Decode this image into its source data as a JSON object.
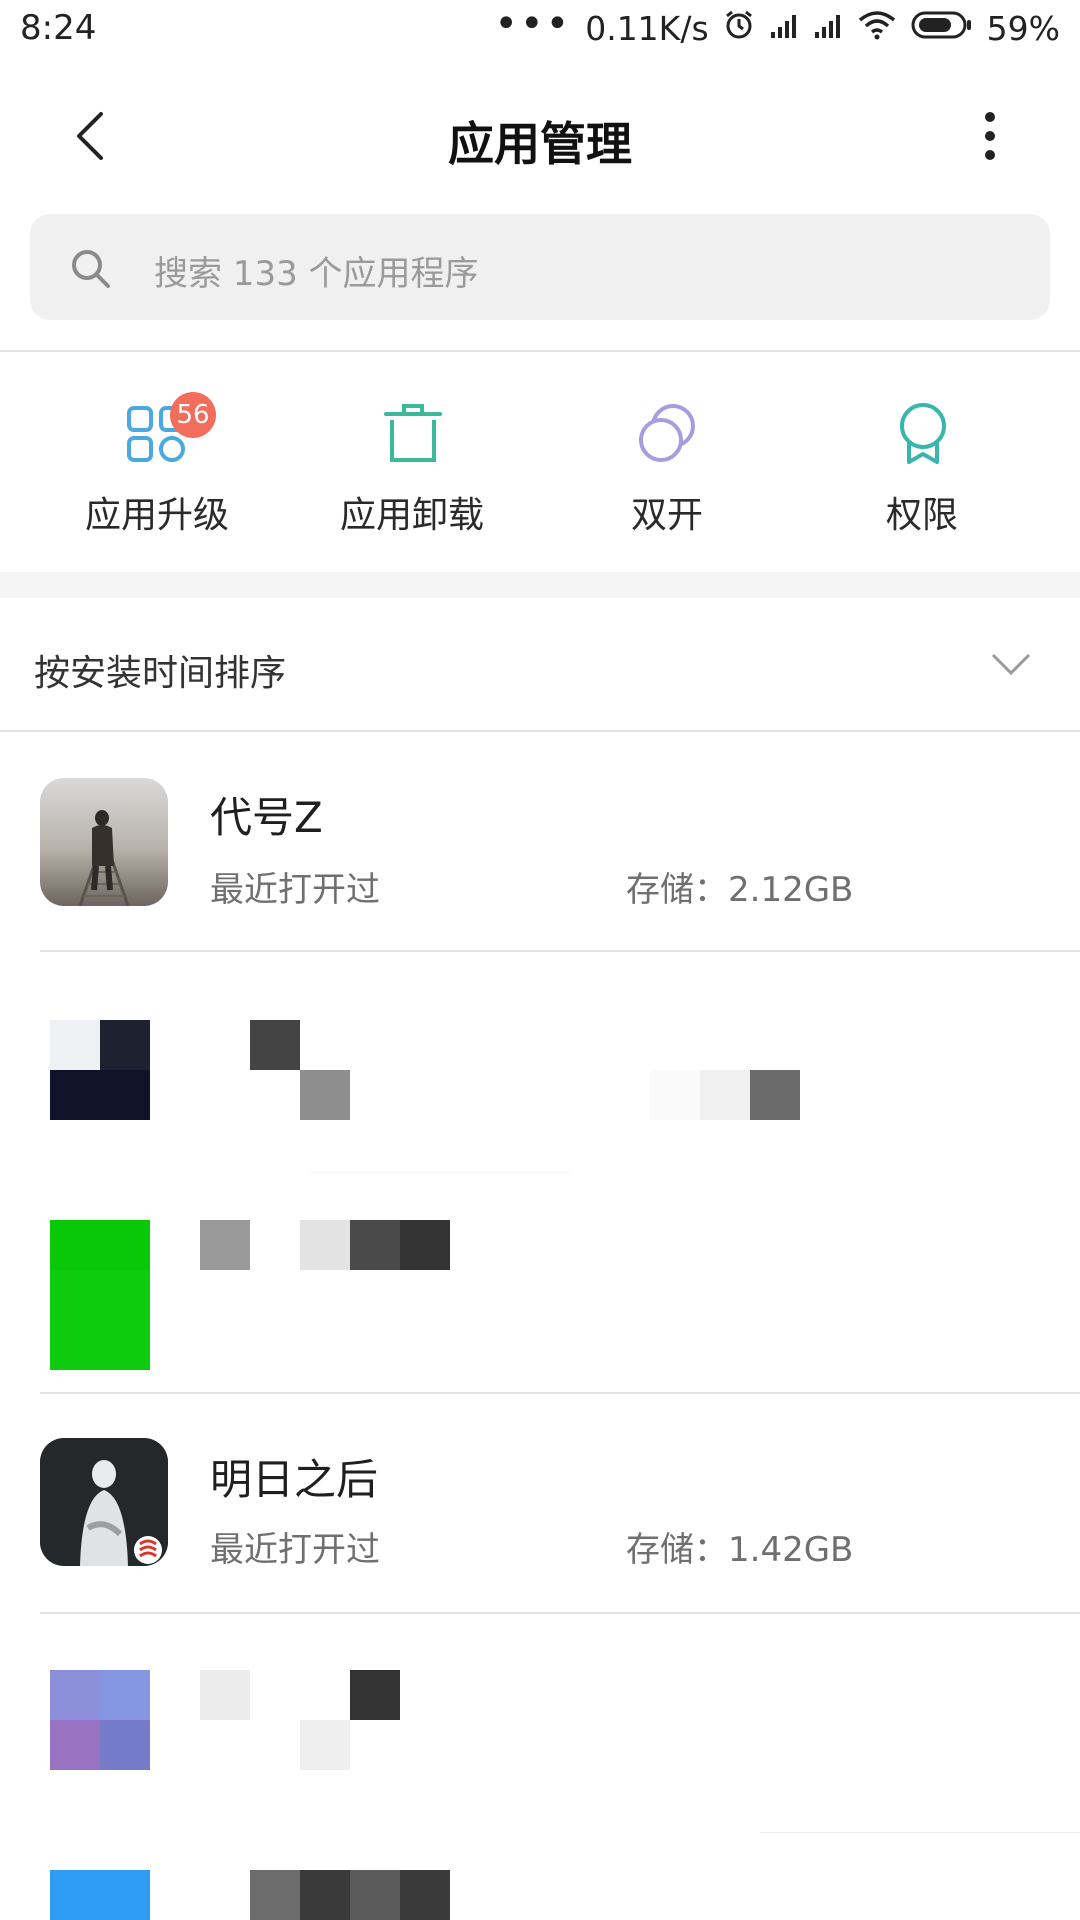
{
  "status_bar": {
    "time": "8:24",
    "dots": "•••",
    "net_speed": "0.11K/s",
    "battery": "59%"
  },
  "header": {
    "title": "应用管理"
  },
  "search": {
    "placeholder": "搜索 133 个应用程序"
  },
  "actions": [
    {
      "label": "应用升级",
      "icon": "apps-update-icon",
      "badge": "56",
      "color": "#4aa9e0"
    },
    {
      "label": "应用卸载",
      "icon": "trash-icon",
      "color": "#3cb89b"
    },
    {
      "label": "双开",
      "icon": "dual-circles-icon",
      "color": "#a99be0"
    },
    {
      "label": "权限",
      "icon": "ribbon-award-icon",
      "color": "#38b6ad"
    }
  ],
  "sort": {
    "label": "按安装时间排序"
  },
  "apps": [
    {
      "name": "代号Z",
      "subtitle": "最近打开过",
      "storage": "存储：2.12GB"
    },
    {
      "name": "明日之后",
      "subtitle": "最近打开过",
      "storage": "存储：1.42GB"
    }
  ],
  "colors": {
    "badge": "#f26d5c",
    "divider": "#e2e2e2",
    "search_bg": "#f0f0f0"
  }
}
